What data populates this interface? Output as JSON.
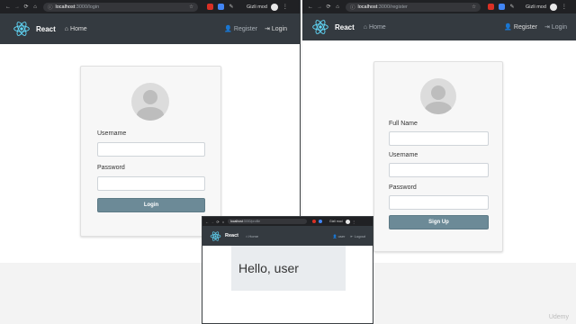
{
  "login_window": {
    "address": {
      "host": "localhost",
      "path": ":3000/login"
    },
    "profile_name": "Gizli mod",
    "navbar": {
      "brand": "React",
      "home": "Home",
      "register": "Register",
      "login": "Login"
    },
    "form": {
      "username_label": "Username",
      "password_label": "Password",
      "button": "Login"
    }
  },
  "register_window": {
    "address": {
      "host": "localhost",
      "path": ":3000/register"
    },
    "profile_name": "Gizli mod",
    "navbar": {
      "brand": "React",
      "home": "Home",
      "register": "Register",
      "login": "Login"
    },
    "form": {
      "fullname_label": "Full Name",
      "username_label": "Username",
      "password_label": "Password",
      "button": "Sign Up"
    }
  },
  "profile_window": {
    "address": {
      "host": "localhost",
      "path": ":3000/profile"
    },
    "profile_name": "Gizli mod",
    "navbar": {
      "brand": "React",
      "home": "Home",
      "user": "user",
      "logout": "Logout"
    },
    "greeting": "Hello, user"
  },
  "colors": {
    "chrome": "#202124",
    "navbar": "#343a40",
    "react": "#61dafb",
    "button": "#6c8a97"
  },
  "watermark": "Udemy"
}
